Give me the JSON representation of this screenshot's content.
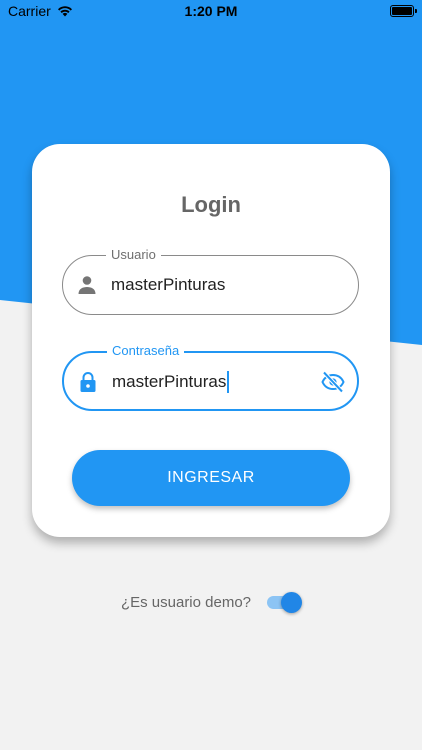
{
  "colors": {
    "primary": "#2196F3",
    "background": "#f2f2f2",
    "card": "#ffffff",
    "title_text": "#666666"
  },
  "status_bar": {
    "carrier": "Carrier",
    "time": "1:20 PM",
    "icons": [
      "wifi-icon",
      "battery-icon"
    ]
  },
  "login": {
    "title": "Login",
    "username": {
      "label": "Usuario",
      "value": "masterPinturas",
      "icon": "person-icon"
    },
    "password": {
      "label": "Contraseña",
      "value": "masterPinturas",
      "icon": "lock-icon",
      "toggle_icon": "eye-off-icon"
    },
    "submit_label": "INGRESAR"
  },
  "demo": {
    "label": "¿Es usuario demo?",
    "enabled": true
  }
}
